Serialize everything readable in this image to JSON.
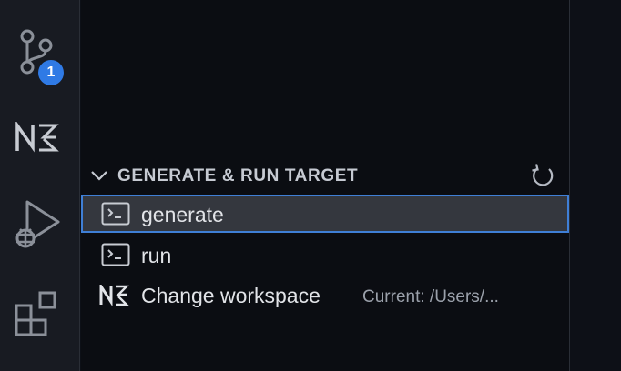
{
  "activity_bar": {
    "items": [
      {
        "name": "source-control",
        "icon": "source-control-icon",
        "badge": "1"
      },
      {
        "name": "nx-console",
        "icon": "nx-logo-icon"
      },
      {
        "name": "run-and-debug",
        "icon": "run-debug-icon"
      },
      {
        "name": "extensions",
        "icon": "extensions-icon"
      }
    ]
  },
  "panel": {
    "section": {
      "title": "GENERATE & RUN TARGET",
      "expanded": true,
      "items": [
        {
          "label": "generate",
          "icon": "terminal-icon",
          "selected": true,
          "description": ""
        },
        {
          "label": "run",
          "icon": "terminal-icon",
          "selected": false,
          "description": ""
        },
        {
          "label": "Change workspace",
          "icon": "nx-logo-icon",
          "selected": false,
          "description": "Current: /Users/..."
        }
      ]
    }
  },
  "colors": {
    "accent": "#2f7ae5",
    "selection_border": "#3f7fd6",
    "selection_bg": "#34373e",
    "activity_bar_bg": "#181b22",
    "panel_bg": "#0b0d12"
  }
}
